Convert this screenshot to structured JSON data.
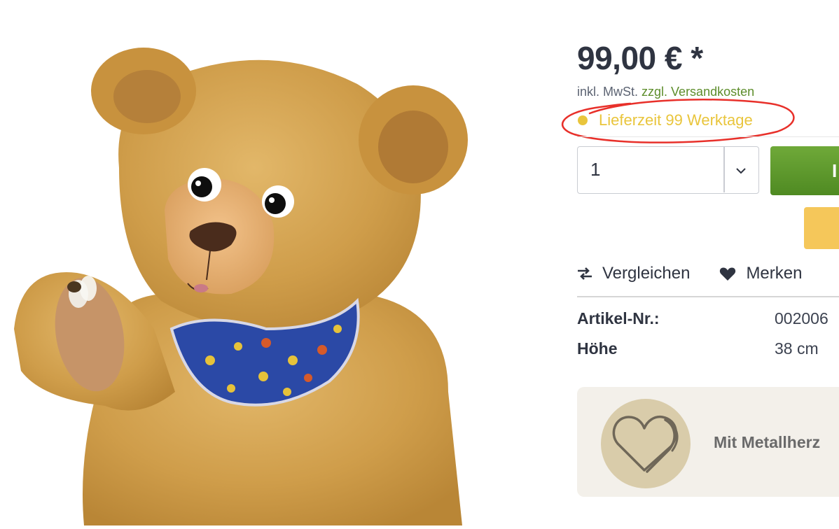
{
  "product": {
    "price": "99,00 € *",
    "tax_prefix": "inkl. MwSt.",
    "shipping_link": "zzgl. Versandkosten",
    "delivery_time": "Lieferzeit 99 Werktage",
    "quantity": "1",
    "buy_button_label": "I"
  },
  "actions": {
    "compare": "Vergleichen",
    "wishlist": "Merken"
  },
  "specs": [
    {
      "label": "Artikel-Nr.:",
      "value": "002006"
    },
    {
      "label": "Höhe",
      "value": "38 cm"
    }
  ],
  "feature": {
    "label": "Mit Metallherz"
  },
  "colors": {
    "price": "#2f3441",
    "delivery_status": "#e9c53c",
    "shipping_link": "#5d8d2b",
    "buy_button": "#5e9a2d",
    "annotation": "#e8302a"
  },
  "icons": [
    "chevron-down-icon",
    "compare-arrows-icon",
    "heart-icon",
    "metal-heart-icon"
  ]
}
